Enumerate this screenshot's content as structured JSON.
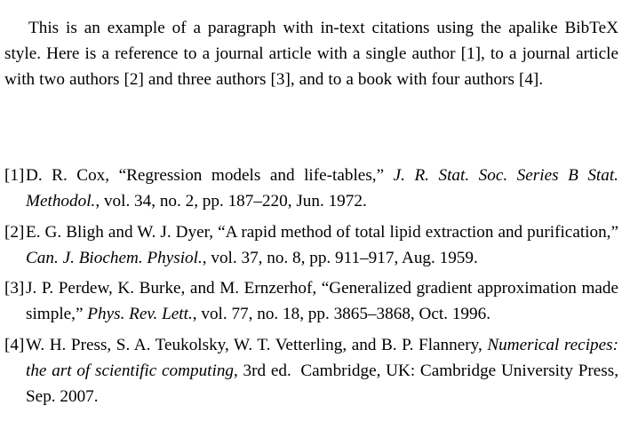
{
  "document": {
    "background_color": "#ffffff",
    "text_color": "#000000",
    "intro_paragraph": "This is an example of a paragraph with in-text citations using the apalike BibTeX style. Here is a reference to a journal article with a single author [1], to a journal article with two authors [2] and three authors [3], and to a book with four authors [4]."
  },
  "bibliography": {
    "entries": [
      {
        "label": "[1]",
        "authors": "D. R. Cox, ",
        "title": "“Regression models and life-tables,” ",
        "source": "J. R. Stat. Soc. Series B Stat. Methodol.",
        "details": ", vol. 34, no. 2, pp. 187–220, Jun. 1972."
      },
      {
        "label": "[2]",
        "authors": "E. G. Bligh and W. J. Dyer, ",
        "title": "“A rapid method of total lipid extraction and purification,” ",
        "source": "Can. J. Biochem. Physiol.",
        "details": ", vol. 37, no. 8, pp. 911–917, Aug. 1959."
      },
      {
        "label": "[3]",
        "authors": "J. P. Perdew, K. Burke, and M. Ernzerhof, ",
        "title": "“Generalized gradient approximation made simple,” ",
        "source": "Phys. Rev. Lett.",
        "details": ", vol. 77, no. 18, pp. 3865–3868, Oct. 1996."
      },
      {
        "label": "[4]",
        "authors": "W. H. Press, S. A. Teukolsky, W. T. Vetterling, and B. P. Flannery, ",
        "title": "",
        "source": "Numerical recipes: the art of scientific computing",
        "details": ", 3rd ed.",
        "details_tail": "Cambridge, UK: Cambridge University Press, Sep. 2007."
      }
    ]
  }
}
